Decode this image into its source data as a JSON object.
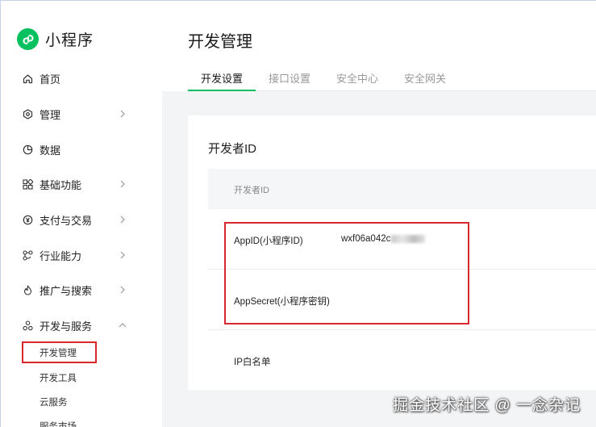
{
  "brand": {
    "name": "小程序",
    "accent": "#07c160"
  },
  "sidebar": {
    "items": [
      {
        "label": "首页",
        "icon": "home-icon",
        "chevron": "none"
      },
      {
        "label": "管理",
        "icon": "settings-icon",
        "chevron": "right"
      },
      {
        "label": "数据",
        "icon": "pie-chart-icon",
        "chevron": "none"
      },
      {
        "label": "基础功能",
        "icon": "grid-icon",
        "chevron": "right"
      },
      {
        "label": "支付与交易",
        "icon": "yen-icon",
        "chevron": "right"
      },
      {
        "label": "行业能力",
        "icon": "link-icon",
        "chevron": "right"
      },
      {
        "label": "推广与搜索",
        "icon": "flame-icon",
        "chevron": "right"
      },
      {
        "label": "开发与服务",
        "icon": "cluster-icon",
        "chevron": "up"
      }
    ],
    "sub_items": [
      "开发管理",
      "开发工具",
      "云服务",
      "服务市场"
    ],
    "active_sub_item": "开发管理"
  },
  "header": {
    "title": "开发管理"
  },
  "tabs": [
    "开发设置",
    "接口设置",
    "安全中心",
    "安全网关"
  ],
  "active_tab": "开发设置",
  "section": {
    "title": "开发者ID",
    "table_header": "开发者ID",
    "rows": [
      {
        "label": "AppID(小程序ID)",
        "value": "wxf06a042c"
      },
      {
        "label": "AppSecret(小程序密钥)",
        "value": ""
      },
      {
        "label": "IP白名单",
        "value": ""
      }
    ]
  },
  "watermark": "掘金技术社区 @ 一念杂记",
  "highlight_color": "#d9272e"
}
